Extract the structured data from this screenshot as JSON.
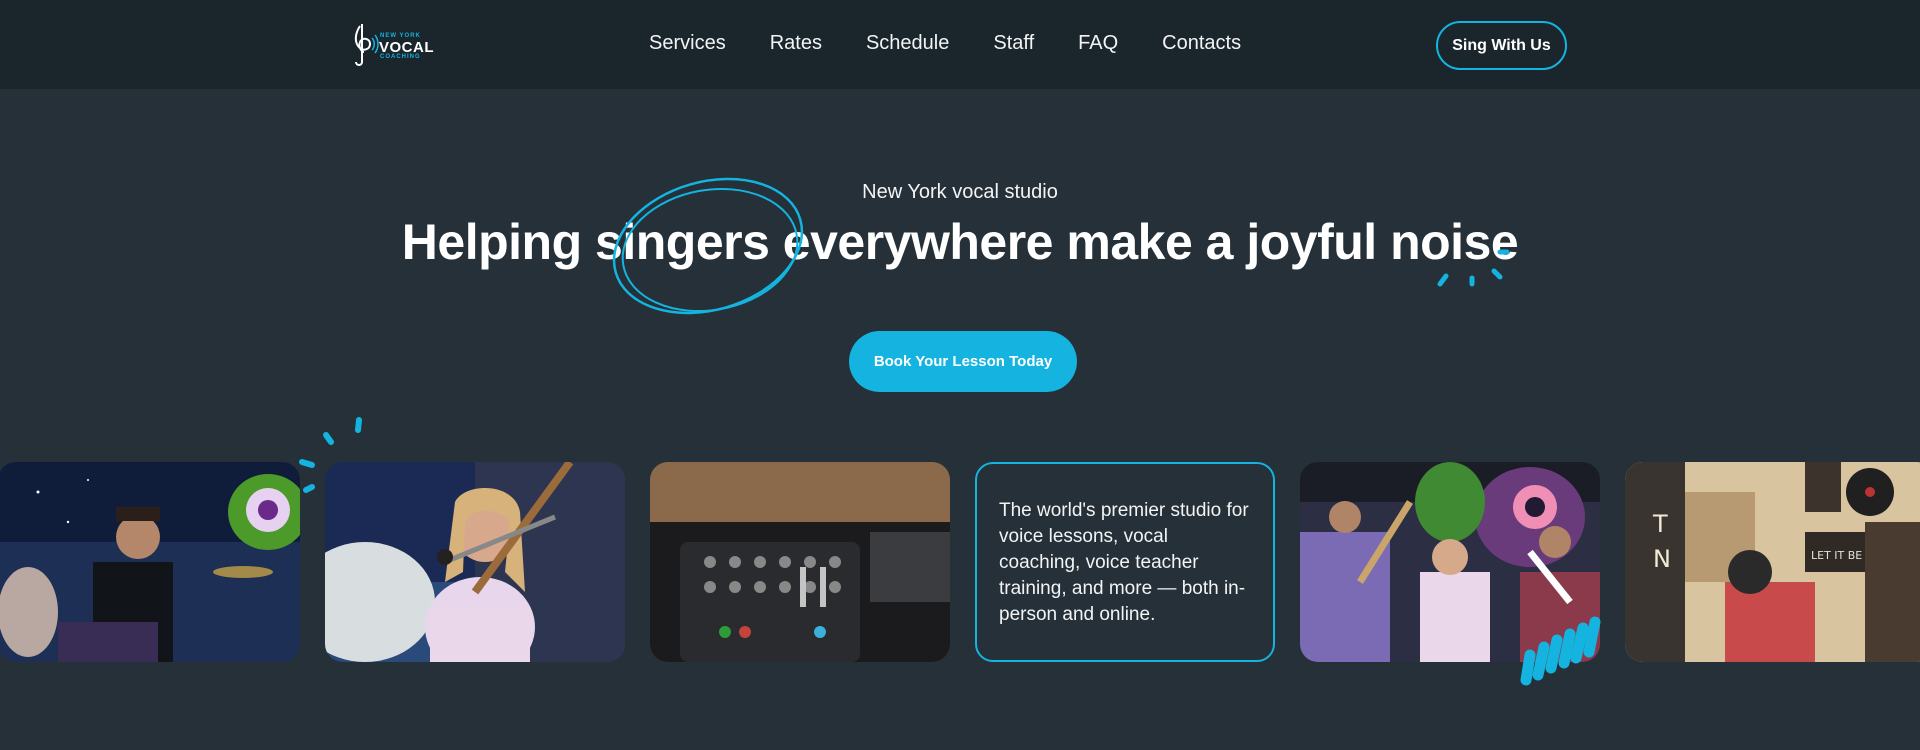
{
  "logo": {
    "line1": "NEW YORK",
    "line2": "VOCAL",
    "line3": "COACHING"
  },
  "nav": {
    "items": [
      "Services",
      "Rates",
      "Schedule",
      "Staff",
      "FAQ",
      "Contacts"
    ]
  },
  "header": {
    "cta_label": "Sing With Us"
  },
  "hero": {
    "eyebrow": "New York vocal studio",
    "headline_parts": [
      "Helping",
      "singers",
      "everywhere make a",
      "joyful noise"
    ],
    "cta_label": "Book Your Lesson Today"
  },
  "gallery": {
    "text_card": "The world's premier studio for voice lessons, vocal coaching, voice teacher training, and more — both in-person and online.",
    "photos": [
      "drummer-photo",
      "singer-guitar-photo",
      "dj-mixer-photo",
      "band-photo",
      "studio-room-photo"
    ]
  },
  "colors": {
    "background": "#253038",
    "header_background": "#1b252c",
    "accent": "#14b3e0",
    "text": "#ffffff"
  }
}
